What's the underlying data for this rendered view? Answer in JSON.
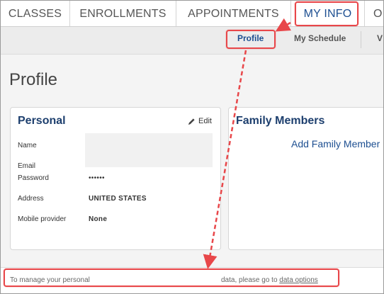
{
  "top_tabs": [
    {
      "label": "CLASSES"
    },
    {
      "label": "ENROLLMENTS"
    },
    {
      "label": "APPOINTMENTS"
    },
    {
      "label": "MY INFO"
    },
    {
      "label": "O"
    }
  ],
  "sub_nav": [
    {
      "label": "Profile"
    },
    {
      "label": "My Schedule"
    },
    {
      "label": "V"
    }
  ],
  "page_title": "Profile",
  "personal": {
    "title": "Personal",
    "edit_label": "Edit",
    "fields": [
      {
        "label": "Name",
        "value": ""
      },
      {
        "label": "Email",
        "value": ""
      },
      {
        "label": "Password",
        "value": "••••••"
      },
      {
        "label": "Address",
        "value": "UNITED STATES"
      },
      {
        "label": "Mobile provider",
        "value": "None"
      }
    ]
  },
  "family": {
    "title": "Family Members",
    "add_label": "Add Family Member"
  },
  "footer": {
    "text_part1": "To manage your personal",
    "text_part2": "data, please go to",
    "link_label": "data options"
  },
  "colors": {
    "highlight": "#e8474a",
    "accent": "#1d4f91",
    "heading": "#1d3f6e"
  }
}
